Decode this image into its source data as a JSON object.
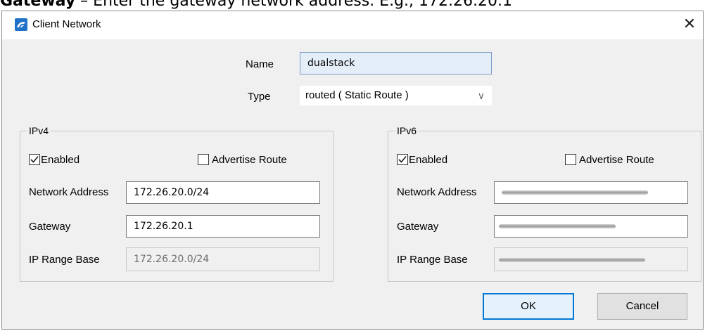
{
  "caption": {
    "bold": "Gateway",
    "text": " – Enter the gateway network address. E.g., 172.26.20.1"
  },
  "window": {
    "title": "Client Network",
    "close_glyph": "✕"
  },
  "form": {
    "name_label": "Name",
    "name_value": "dualstack",
    "type_label": "Type",
    "type_value": "routed  ( Static Route )",
    "type_chevron": "∨"
  },
  "ipv4": {
    "title": "IPv4",
    "enabled_label": "Enabled",
    "enabled_checked": true,
    "advertise_label": "Advertise Route",
    "advertise_checked": false,
    "network_label": "Network Address",
    "network_value": "172.26.20.0/24",
    "gateway_label": "Gateway",
    "gateway_value": "172.26.20.1",
    "range_label": "IP Range Base",
    "range_value": "172.26.20.0/24"
  },
  "ipv6": {
    "title": "IPv6",
    "enabled_label": "Enabled",
    "enabled_checked": true,
    "advertise_label": "Advertise Route",
    "advertise_checked": false,
    "network_label": "Network Address",
    "gateway_label": "Gateway",
    "range_label": "IP Range Base"
  },
  "buttons": {
    "ok": "OK",
    "cancel": "Cancel"
  },
  "colors": {
    "accent": "#0078d7",
    "focused_field": "#e4eef9",
    "dialog_bg": "#f0f0f0"
  }
}
